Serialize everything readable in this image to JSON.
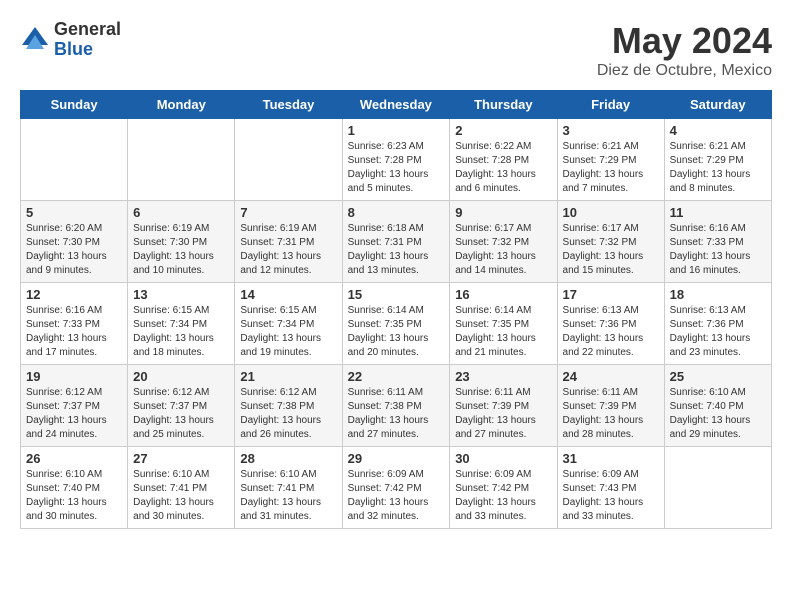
{
  "logo": {
    "general": "General",
    "blue": "Blue"
  },
  "header": {
    "month": "May 2024",
    "location": "Diez de Octubre, Mexico"
  },
  "weekdays": [
    "Sunday",
    "Monday",
    "Tuesday",
    "Wednesday",
    "Thursday",
    "Friday",
    "Saturday"
  ],
  "weeks": [
    [
      {
        "day": "",
        "sunrise": "",
        "sunset": "",
        "daylight": ""
      },
      {
        "day": "",
        "sunrise": "",
        "sunset": "",
        "daylight": ""
      },
      {
        "day": "",
        "sunrise": "",
        "sunset": "",
        "daylight": ""
      },
      {
        "day": "1",
        "sunrise": "Sunrise: 6:23 AM",
        "sunset": "Sunset: 7:28 PM",
        "daylight": "Daylight: 13 hours and 5 minutes."
      },
      {
        "day": "2",
        "sunrise": "Sunrise: 6:22 AM",
        "sunset": "Sunset: 7:28 PM",
        "daylight": "Daylight: 13 hours and 6 minutes."
      },
      {
        "day": "3",
        "sunrise": "Sunrise: 6:21 AM",
        "sunset": "Sunset: 7:29 PM",
        "daylight": "Daylight: 13 hours and 7 minutes."
      },
      {
        "day": "4",
        "sunrise": "Sunrise: 6:21 AM",
        "sunset": "Sunset: 7:29 PM",
        "daylight": "Daylight: 13 hours and 8 minutes."
      }
    ],
    [
      {
        "day": "5",
        "sunrise": "Sunrise: 6:20 AM",
        "sunset": "Sunset: 7:30 PM",
        "daylight": "Daylight: 13 hours and 9 minutes."
      },
      {
        "day": "6",
        "sunrise": "Sunrise: 6:19 AM",
        "sunset": "Sunset: 7:30 PM",
        "daylight": "Daylight: 13 hours and 10 minutes."
      },
      {
        "day": "7",
        "sunrise": "Sunrise: 6:19 AM",
        "sunset": "Sunset: 7:31 PM",
        "daylight": "Daylight: 13 hours and 12 minutes."
      },
      {
        "day": "8",
        "sunrise": "Sunrise: 6:18 AM",
        "sunset": "Sunset: 7:31 PM",
        "daylight": "Daylight: 13 hours and 13 minutes."
      },
      {
        "day": "9",
        "sunrise": "Sunrise: 6:17 AM",
        "sunset": "Sunset: 7:32 PM",
        "daylight": "Daylight: 13 hours and 14 minutes."
      },
      {
        "day": "10",
        "sunrise": "Sunrise: 6:17 AM",
        "sunset": "Sunset: 7:32 PM",
        "daylight": "Daylight: 13 hours and 15 minutes."
      },
      {
        "day": "11",
        "sunrise": "Sunrise: 6:16 AM",
        "sunset": "Sunset: 7:33 PM",
        "daylight": "Daylight: 13 hours and 16 minutes."
      }
    ],
    [
      {
        "day": "12",
        "sunrise": "Sunrise: 6:16 AM",
        "sunset": "Sunset: 7:33 PM",
        "daylight": "Daylight: 13 hours and 17 minutes."
      },
      {
        "day": "13",
        "sunrise": "Sunrise: 6:15 AM",
        "sunset": "Sunset: 7:34 PM",
        "daylight": "Daylight: 13 hours and 18 minutes."
      },
      {
        "day": "14",
        "sunrise": "Sunrise: 6:15 AM",
        "sunset": "Sunset: 7:34 PM",
        "daylight": "Daylight: 13 hours and 19 minutes."
      },
      {
        "day": "15",
        "sunrise": "Sunrise: 6:14 AM",
        "sunset": "Sunset: 7:35 PM",
        "daylight": "Daylight: 13 hours and 20 minutes."
      },
      {
        "day": "16",
        "sunrise": "Sunrise: 6:14 AM",
        "sunset": "Sunset: 7:35 PM",
        "daylight": "Daylight: 13 hours and 21 minutes."
      },
      {
        "day": "17",
        "sunrise": "Sunrise: 6:13 AM",
        "sunset": "Sunset: 7:36 PM",
        "daylight": "Daylight: 13 hours and 22 minutes."
      },
      {
        "day": "18",
        "sunrise": "Sunrise: 6:13 AM",
        "sunset": "Sunset: 7:36 PM",
        "daylight": "Daylight: 13 hours and 23 minutes."
      }
    ],
    [
      {
        "day": "19",
        "sunrise": "Sunrise: 6:12 AM",
        "sunset": "Sunset: 7:37 PM",
        "daylight": "Daylight: 13 hours and 24 minutes."
      },
      {
        "day": "20",
        "sunrise": "Sunrise: 6:12 AM",
        "sunset": "Sunset: 7:37 PM",
        "daylight": "Daylight: 13 hours and 25 minutes."
      },
      {
        "day": "21",
        "sunrise": "Sunrise: 6:12 AM",
        "sunset": "Sunset: 7:38 PM",
        "daylight": "Daylight: 13 hours and 26 minutes."
      },
      {
        "day": "22",
        "sunrise": "Sunrise: 6:11 AM",
        "sunset": "Sunset: 7:38 PM",
        "daylight": "Daylight: 13 hours and 27 minutes."
      },
      {
        "day": "23",
        "sunrise": "Sunrise: 6:11 AM",
        "sunset": "Sunset: 7:39 PM",
        "daylight": "Daylight: 13 hours and 27 minutes."
      },
      {
        "day": "24",
        "sunrise": "Sunrise: 6:11 AM",
        "sunset": "Sunset: 7:39 PM",
        "daylight": "Daylight: 13 hours and 28 minutes."
      },
      {
        "day": "25",
        "sunrise": "Sunrise: 6:10 AM",
        "sunset": "Sunset: 7:40 PM",
        "daylight": "Daylight: 13 hours and 29 minutes."
      }
    ],
    [
      {
        "day": "26",
        "sunrise": "Sunrise: 6:10 AM",
        "sunset": "Sunset: 7:40 PM",
        "daylight": "Daylight: 13 hours and 30 minutes."
      },
      {
        "day": "27",
        "sunrise": "Sunrise: 6:10 AM",
        "sunset": "Sunset: 7:41 PM",
        "daylight": "Daylight: 13 hours and 30 minutes."
      },
      {
        "day": "28",
        "sunrise": "Sunrise: 6:10 AM",
        "sunset": "Sunset: 7:41 PM",
        "daylight": "Daylight: 13 hours and 31 minutes."
      },
      {
        "day": "29",
        "sunrise": "Sunrise: 6:09 AM",
        "sunset": "Sunset: 7:42 PM",
        "daylight": "Daylight: 13 hours and 32 minutes."
      },
      {
        "day": "30",
        "sunrise": "Sunrise: 6:09 AM",
        "sunset": "Sunset: 7:42 PM",
        "daylight": "Daylight: 13 hours and 33 minutes."
      },
      {
        "day": "31",
        "sunrise": "Sunrise: 6:09 AM",
        "sunset": "Sunset: 7:43 PM",
        "daylight": "Daylight: 13 hours and 33 minutes."
      },
      {
        "day": "",
        "sunrise": "",
        "sunset": "",
        "daylight": ""
      }
    ]
  ]
}
